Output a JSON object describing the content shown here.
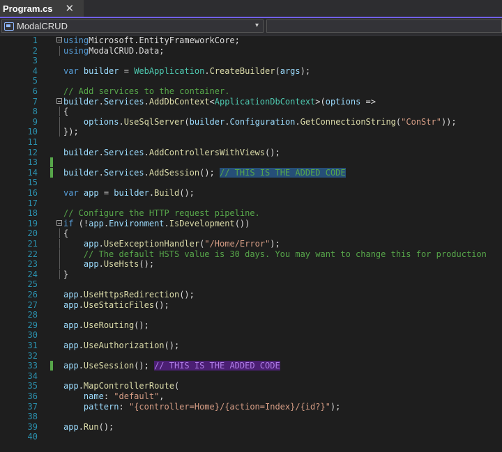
{
  "tab": {
    "title": "Program.cs",
    "pin_glyph": "⴫",
    "close_glyph": "✕"
  },
  "nav": {
    "project": "ModalCRUD",
    "dropdown_glyph": "▾"
  },
  "colors": {
    "accent": "#7160e8",
    "change_marker": "#57a64a",
    "line_number": "#2b91af"
  },
  "code_lines": [
    {
      "n": "1",
      "fold": true,
      "tokens": [
        [
          "kw",
          "using"
        ],
        [
          "",
          "Microsoft.EntityFrameworkCore;"
        ]
      ]
    },
    {
      "n": "2",
      "guide": true,
      "tokens": [
        [
          "kw",
          "using"
        ],
        [
          "",
          "ModalCRUD.Data;"
        ]
      ]
    },
    {
      "n": "3",
      "tokens": []
    },
    {
      "n": "4",
      "tokens": [
        [
          "kw",
          "var"
        ],
        [
          "",
          " "
        ],
        [
          "va",
          "builder"
        ],
        [
          "",
          " = "
        ],
        [
          "ty",
          "WebApplication"
        ],
        [
          "",
          "."
        ],
        [
          "fn",
          "CreateBuilder"
        ],
        [
          "",
          "("
        ],
        [
          "va",
          "args"
        ],
        [
          "",
          ");"
        ]
      ]
    },
    {
      "n": "5",
      "tokens": []
    },
    {
      "n": "6",
      "tokens": [
        [
          "cm",
          "// Add services to the container."
        ]
      ]
    },
    {
      "n": "7",
      "fold": true,
      "tokens": [
        [
          "va",
          "builder"
        ],
        [
          "",
          "."
        ],
        [
          "va",
          "Services"
        ],
        [
          "",
          "."
        ],
        [
          "fn",
          "AddDbContext"
        ],
        [
          "",
          "<"
        ],
        [
          "ty",
          "ApplicationDbContext"
        ],
        [
          "",
          ">("
        ],
        [
          "va",
          "options"
        ],
        [
          "",
          " =>"
        ]
      ]
    },
    {
      "n": "8",
      "guide": true,
      "tokens": [
        [
          "",
          "{"
        ]
      ]
    },
    {
      "n": "9",
      "guide": true,
      "tokens": [
        [
          "",
          "    "
        ],
        [
          "va",
          "options"
        ],
        [
          "",
          "."
        ],
        [
          "fn",
          "UseSqlServer"
        ],
        [
          "",
          "("
        ],
        [
          "va",
          "builder"
        ],
        [
          "",
          "."
        ],
        [
          "va",
          "Configuration"
        ],
        [
          "",
          "."
        ],
        [
          "fn",
          "GetConnectionString"
        ],
        [
          "",
          "("
        ],
        [
          "st",
          "\"ConStr\""
        ],
        [
          "",
          "));"
        ]
      ]
    },
    {
      "n": "10",
      "guide": true,
      "tokens": [
        [
          "",
          "});"
        ]
      ]
    },
    {
      "n": "11",
      "tokens": []
    },
    {
      "n": "12",
      "tokens": [
        [
          "va",
          "builder"
        ],
        [
          "",
          "."
        ],
        [
          "va",
          "Services"
        ],
        [
          "",
          "."
        ],
        [
          "fn",
          "AddControllersWithViews"
        ],
        [
          "",
          "();"
        ]
      ]
    },
    {
      "n": "13",
      "changed": true,
      "tokens": []
    },
    {
      "n": "14",
      "changed": true,
      "tokens": [
        [
          "va",
          "builder"
        ],
        [
          "",
          "."
        ],
        [
          "va",
          "Services"
        ],
        [
          "",
          "."
        ],
        [
          "fn",
          "AddSession"
        ],
        [
          "",
          "(); "
        ],
        [
          "sel-blue",
          "// THIS IS THE ADDED CODE"
        ]
      ]
    },
    {
      "n": "15",
      "tokens": []
    },
    {
      "n": "16",
      "tokens": [
        [
          "kw",
          "var"
        ],
        [
          "",
          " "
        ],
        [
          "va",
          "app"
        ],
        [
          "",
          " = "
        ],
        [
          "va",
          "builder"
        ],
        [
          "",
          "."
        ],
        [
          "fn",
          "Build"
        ],
        [
          "",
          "();"
        ]
      ]
    },
    {
      "n": "17",
      "tokens": []
    },
    {
      "n": "18",
      "tokens": [
        [
          "cm",
          "// Configure the HTTP request pipeline."
        ]
      ]
    },
    {
      "n": "19",
      "fold": true,
      "tokens": [
        [
          "kw",
          "if"
        ],
        [
          "",
          " (!"
        ],
        [
          "va",
          "app"
        ],
        [
          "",
          "."
        ],
        [
          "va",
          "Environment"
        ],
        [
          "",
          "."
        ],
        [
          "fn",
          "IsDevelopment"
        ],
        [
          "",
          "())"
        ]
      ]
    },
    {
      "n": "20",
      "guide": true,
      "tokens": [
        [
          "",
          "{"
        ]
      ]
    },
    {
      "n": "21",
      "guide": true,
      "tokens": [
        [
          "",
          "    "
        ],
        [
          "va",
          "app"
        ],
        [
          "",
          "."
        ],
        [
          "fn",
          "UseExceptionHandler"
        ],
        [
          "",
          "("
        ],
        [
          "st",
          "\"/Home/Error\""
        ],
        [
          "",
          ");"
        ]
      ]
    },
    {
      "n": "22",
      "guide": true,
      "tokens": [
        [
          "",
          "    "
        ],
        [
          "cm",
          "// The default HSTS value is 30 days. You may want to change this for production"
        ]
      ]
    },
    {
      "n": "23",
      "guide": true,
      "tokens": [
        [
          "",
          "    "
        ],
        [
          "va",
          "app"
        ],
        [
          "",
          "."
        ],
        [
          "fn",
          "UseHsts"
        ],
        [
          "",
          "();"
        ]
      ]
    },
    {
      "n": "24",
      "guide": true,
      "tokens": [
        [
          "",
          "}"
        ]
      ]
    },
    {
      "n": "25",
      "tokens": []
    },
    {
      "n": "26",
      "tokens": [
        [
          "va",
          "app"
        ],
        [
          "",
          "."
        ],
        [
          "fn",
          "UseHttpsRedirection"
        ],
        [
          "",
          "();"
        ]
      ]
    },
    {
      "n": "27",
      "tokens": [
        [
          "va",
          "app"
        ],
        [
          "",
          "."
        ],
        [
          "fn",
          "UseStaticFiles"
        ],
        [
          "",
          "();"
        ]
      ]
    },
    {
      "n": "28",
      "tokens": []
    },
    {
      "n": "29",
      "tokens": [
        [
          "va",
          "app"
        ],
        [
          "",
          "."
        ],
        [
          "fn",
          "UseRouting"
        ],
        [
          "",
          "();"
        ]
      ]
    },
    {
      "n": "30",
      "tokens": []
    },
    {
      "n": "31",
      "tokens": [
        [
          "va",
          "app"
        ],
        [
          "",
          "."
        ],
        [
          "fn",
          "UseAuthorization"
        ],
        [
          "",
          "();"
        ]
      ]
    },
    {
      "n": "32",
      "tokens": []
    },
    {
      "n": "33",
      "changed": true,
      "tokens": [
        [
          "va",
          "app"
        ],
        [
          "",
          "."
        ],
        [
          "fn",
          "UseSession"
        ],
        [
          "",
          "(); "
        ],
        [
          "sel-purple",
          "// THIS IS THE ADDED CODE"
        ]
      ]
    },
    {
      "n": "34",
      "tokens": []
    },
    {
      "n": "35",
      "tokens": [
        [
          "va",
          "app"
        ],
        [
          "",
          "."
        ],
        [
          "fn",
          "MapControllerRoute"
        ],
        [
          "",
          "("
        ]
      ]
    },
    {
      "n": "36",
      "tokens": [
        [
          "",
          "    "
        ],
        [
          "va",
          "name"
        ],
        [
          "",
          ": "
        ],
        [
          "st",
          "\"default\""
        ],
        [
          "",
          ","
        ]
      ]
    },
    {
      "n": "37",
      "tokens": [
        [
          "",
          "    "
        ],
        [
          "va",
          "pattern"
        ],
        [
          "",
          ": "
        ],
        [
          "st",
          "\"{controller=Home}/{action=Index}/{id?}\""
        ],
        [
          "",
          ");"
        ]
      ]
    },
    {
      "n": "38",
      "tokens": []
    },
    {
      "n": "39",
      "tokens": [
        [
          "va",
          "app"
        ],
        [
          "",
          "."
        ],
        [
          "fn",
          "Run"
        ],
        [
          "",
          "();"
        ]
      ]
    },
    {
      "n": "40",
      "tokens": []
    }
  ]
}
